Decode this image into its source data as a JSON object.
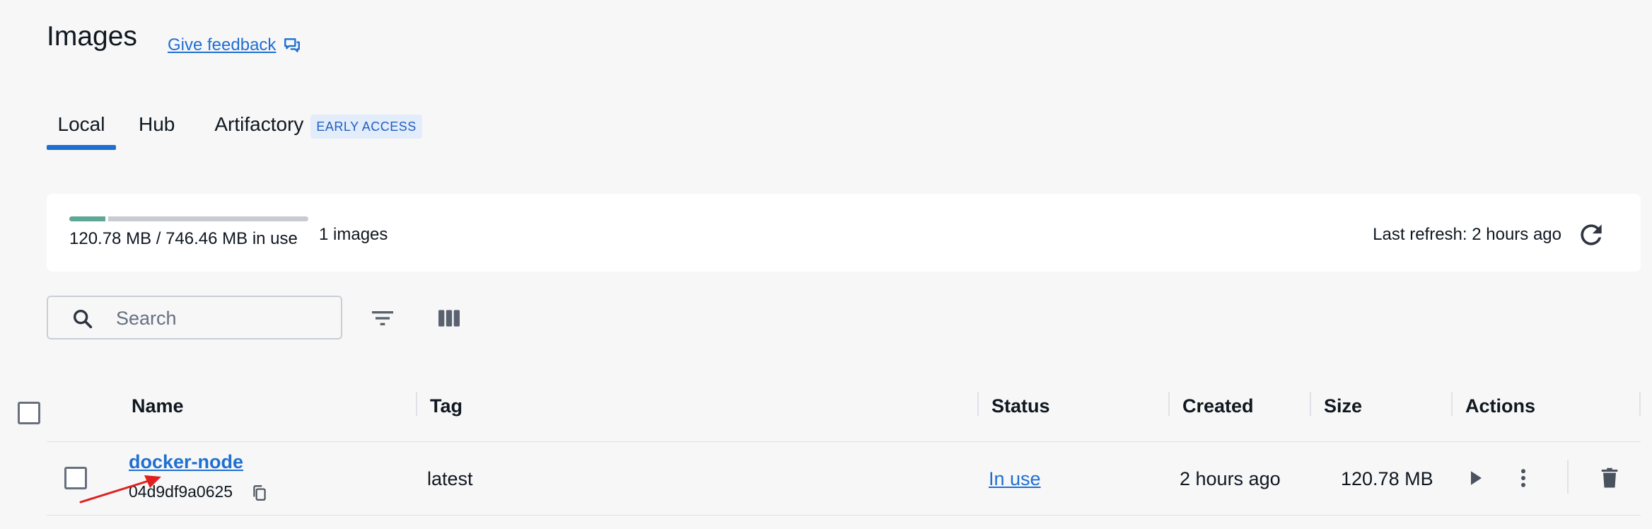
{
  "header": {
    "title": "Images",
    "feedback_label": "Give feedback"
  },
  "tabs": [
    {
      "label": "Local",
      "active": true
    },
    {
      "label": "Hub",
      "active": false
    },
    {
      "label": "Artifactory",
      "badge": "EARLY ACCESS",
      "active": false
    }
  ],
  "usage": {
    "text": "120.78 MB / 746.46 MB in use",
    "fraction": 0.162,
    "image_count": "1 images",
    "last_refresh": "Last refresh: 2 hours ago"
  },
  "toolbar": {
    "search_placeholder": "Search",
    "search_value": ""
  },
  "table": {
    "columns": [
      "Name",
      "Tag",
      "Status",
      "Created",
      "Size",
      "Actions"
    ],
    "rows": [
      {
        "name": "docker-node",
        "id": "04d9df9a0625",
        "tag": "latest",
        "status": "In use",
        "created": "2 hours ago",
        "size": "120.78 MB"
      }
    ]
  },
  "colors": {
    "accent": "#1f6fd1",
    "usage_fill": "#5da896",
    "usage_track": "#c7ccd3",
    "annotation_arrow": "#e0201f"
  },
  "icons": {
    "feedback": "feedback-icon",
    "refresh": "refresh-icon",
    "search": "search-icon",
    "filter": "filter-icon",
    "columns": "columns-icon",
    "copy": "copy-icon",
    "run": "play-icon",
    "more": "more-vertical-icon",
    "delete": "trash-icon"
  }
}
